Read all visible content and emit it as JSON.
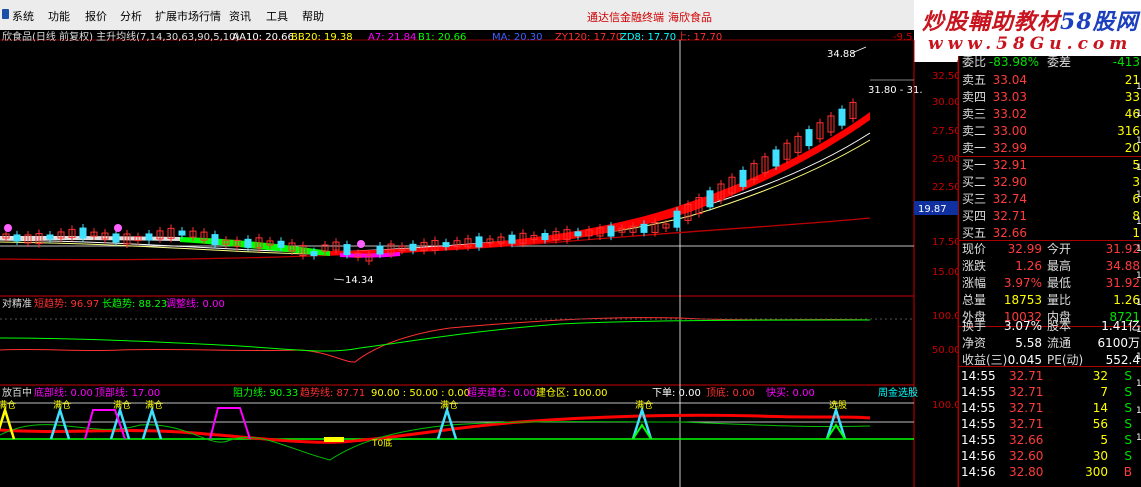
{
  "menu": {
    "items": [
      "系统",
      "功能",
      "报价",
      "分析",
      "扩展市场行情",
      "资讯",
      "工具",
      "帮助"
    ],
    "promo1": "通达信金融终端",
    "promo2": "海欣食品"
  },
  "watermark": {
    "title_a": "炒股輔助教材",
    "title_b": "58股网",
    "url": "www.58Gu.com"
  },
  "indicator_bar": {
    "stock": "欣食品(日线 前复权) 主升均线(7,14,30,63,90,5,10)",
    "aa10": "AA10: 20.66",
    "bb20": "BB20: 19.38",
    "a7": "A7: 21.84",
    "b1": "B1: 20.66",
    "ma": "MA: 20.30",
    "zy120": "ZY120: 17.70",
    "zd8": "ZD8: 17.70",
    "top": "上: 17.70"
  },
  "price_axis": [
    "32.50",
    "30.00",
    "27.50",
    "25.00",
    "22.50",
    "20.00",
    "17.50",
    "15.00"
  ],
  "price_marker": "19.87",
  "annotations": {
    "high": "34.88",
    "low": "14.34",
    "last_range": "31.80 - 31.",
    "right_cut": "-9.5"
  },
  "sub1": {
    "title": "对精准",
    "short": "短趋势: 96.97",
    "long": "长趋势: 88.23",
    "adjust": "调整线: 0.00",
    "axis": [
      "100.00",
      "50.00"
    ]
  },
  "sub2": {
    "title": "放百中",
    "low_bottom": "底部线: 0.00",
    "top_line": "顶部线: 17.00",
    "support": "阻力线: 90.33",
    "trend": "趋势线: 87.71",
    "ref": "90.00 : 50.00 : 0.00",
    "chaodi": "超卖建仓: 0.00",
    "buildzone": "建仓区: 100.00",
    "down": "下单: 0.00",
    "short_top": "顶底: 0.00",
    "fast": "快买: 0.00",
    "right_tag": "周金选股",
    "axis": "100.0",
    "marks": [
      "满仓",
      "满仓",
      "满仓",
      "满仓",
      "满仓",
      "满仓",
      "选股"
    ],
    "buy_label": "T0底"
  },
  "quote": {
    "wei": {
      "label": "委比",
      "value": "-83.98%",
      "label2": "委差",
      "value2": "-413"
    },
    "asks": [
      {
        "label": "卖五",
        "price": "33.04",
        "vol": "21"
      },
      {
        "label": "卖四",
        "price": "33.03",
        "vol": "33"
      },
      {
        "label": "卖三",
        "price": "33.02",
        "vol": "46"
      },
      {
        "label": "卖二",
        "price": "33.00",
        "vol": "316"
      },
      {
        "label": "卖一",
        "price": "32.99",
        "vol": "20"
      }
    ],
    "bids": [
      {
        "label": "买一",
        "price": "32.91",
        "vol": "5"
      },
      {
        "label": "买二",
        "price": "32.90",
        "vol": "3"
      },
      {
        "label": "买三",
        "price": "32.74",
        "vol": "6"
      },
      {
        "label": "买四",
        "price": "32.71",
        "vol": "8"
      },
      {
        "label": "买五",
        "price": "32.66",
        "vol": "1"
      }
    ],
    "stats": [
      {
        "l1": "现价",
        "v1": "32.99",
        "l2": "今开",
        "v2": "31.92"
      },
      {
        "l1": "涨跌",
        "v1": "1.26",
        "l2": "最高",
        "v2": "34.88"
      },
      {
        "l1": "涨幅",
        "v1": "3.97%",
        "l2": "最低",
        "v2": "31.92"
      },
      {
        "l1": "总量",
        "v1": "18753",
        "l2": "量比",
        "v2": "1.26"
      },
      {
        "l1": "外盘",
        "v1": "10032",
        "l2": "内盘",
        "v2": "8721"
      }
    ],
    "fund": [
      {
        "l1": "换手",
        "v1": "3.07%",
        "l2": "股本",
        "v2": "1.41亿"
      },
      {
        "l1": "净资",
        "v1": "5.58",
        "l2": "流通",
        "v2": "6100万"
      },
      {
        "l1": "收益(三)",
        "v1": "0.045",
        "l2": "PE(动)",
        "v2": "552.4"
      }
    ],
    "ticks": [
      {
        "t": "14:55",
        "p": "32.71",
        "q": "32",
        "s": "S"
      },
      {
        "t": "14:55",
        "p": "32.71",
        "q": "7",
        "s": "S"
      },
      {
        "t": "14:55",
        "p": "32.71",
        "q": "14",
        "s": "S"
      },
      {
        "t": "14:55",
        "p": "32.71",
        "q": "56",
        "s": "S"
      },
      {
        "t": "14:55",
        "p": "32.66",
        "q": "5",
        "s": "S"
      },
      {
        "t": "14:56",
        "p": "32.60",
        "q": "30",
        "s": "S"
      },
      {
        "t": "14:56",
        "p": "32.80",
        "q": "300",
        "s": "B"
      }
    ],
    "side_digits": [
      "1",
      "1",
      "1",
      "1",
      "1",
      "1",
      "1",
      "1",
      "1",
      "1",
      "1",
      "1",
      "1",
      "1"
    ]
  },
  "colors": {
    "up": "#ff0000",
    "down": "#00ffff",
    "ma_white": "#ffffff",
    "ma_yellow": "#ffff00",
    "green": "#00ff00",
    "magenta": "#ff00ff",
    "ribbon": "#ff0000"
  }
}
